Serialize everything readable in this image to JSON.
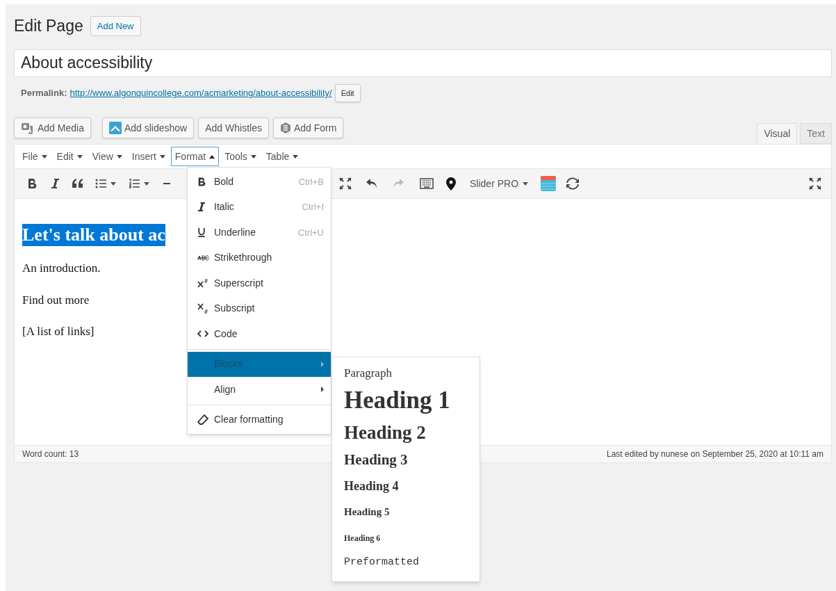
{
  "header": {
    "title": "Edit Page",
    "add_new": "Add New"
  },
  "post_title": "About accessibility",
  "permalink": {
    "label": "Permalink:",
    "url": "http://www.algonquincollege.com/acmarketing/about-accessibility/",
    "edit": "Edit"
  },
  "media_buttons": [
    {
      "label": "Add Media"
    },
    {
      "label": "Add slideshow"
    },
    {
      "label": "Add Whistles"
    },
    {
      "label": "Add Form"
    }
  ],
  "editor_tabs": [
    {
      "label": "Visual",
      "selected": true
    },
    {
      "label": "Text",
      "selected": false
    }
  ],
  "menubar": [
    {
      "label": "File",
      "selected": false
    },
    {
      "label": "Edit",
      "selected": false
    },
    {
      "label": "View",
      "selected": false
    },
    {
      "label": "Insert",
      "selected": false
    },
    {
      "label": "Format",
      "selected": true
    },
    {
      "label": "Tools",
      "selected": false
    },
    {
      "label": "Table",
      "selected": false
    }
  ],
  "toolbar": {
    "slider_dropdown": "Slider PRO"
  },
  "content": {
    "heading": "Let's talk about ac",
    "paragraphs": [
      "An introduction.",
      "Find out more",
      "[A list of links]"
    ]
  },
  "format_menu": [
    [
      {
        "label": "Bold",
        "shortcut": "Ctrl+B"
      },
      {
        "label": "Italic",
        "shortcut": "Ctrl+I"
      },
      {
        "label": "Underline",
        "shortcut": "Ctrl+U"
      },
      {
        "label": "Strikethrough"
      },
      {
        "label": "Superscript"
      },
      {
        "label": "Subscript"
      },
      {
        "label": "Code"
      }
    ],
    [
      {
        "label": "Blocks",
        "selected": true,
        "submenu": true
      },
      {
        "label": "Align",
        "selected": false,
        "submenu": true
      }
    ],
    [
      {
        "label": "Clear formatting"
      }
    ]
  ],
  "blocks_menu": [
    {
      "label": "Paragraph",
      "kind": "p"
    },
    {
      "label": "Heading 1",
      "kind": "h1"
    },
    {
      "label": "Heading 2",
      "kind": "h2"
    },
    {
      "label": "Heading 3",
      "kind": "h3"
    },
    {
      "label": "Heading 4",
      "kind": "h4"
    },
    {
      "label": "Heading 5",
      "kind": "h5"
    },
    {
      "label": "Heading 6",
      "kind": "h6"
    },
    {
      "label": "Preformatted",
      "kind": "pre"
    }
  ],
  "status_bar": {
    "word_count": "Word count: 13",
    "last_edited": "Last edited by nunese on September 25, 2020 at 10:11 am"
  }
}
